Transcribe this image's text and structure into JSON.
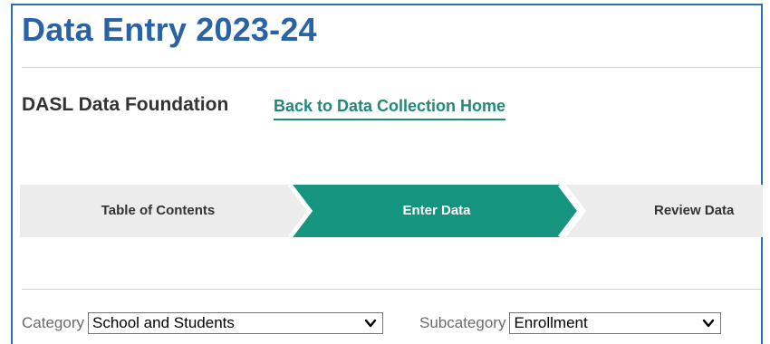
{
  "header": {
    "title": "Data Entry 2023-24"
  },
  "subheader": {
    "org_name": "DASL Data Foundation",
    "back_link": "Back to Data Collection Home"
  },
  "steps": [
    {
      "label": "Table of Contents",
      "state": "inactive"
    },
    {
      "label": "Enter Data",
      "state": "active"
    },
    {
      "label": "Review Data",
      "state": "inactive"
    }
  ],
  "filters": {
    "category": {
      "label": "Category",
      "value": "School and Students"
    },
    "subcategory": {
      "label": "Subcategory",
      "value": "Enrollment"
    }
  },
  "colors": {
    "title": "#2a62a6",
    "frame_border": "#2e6db3",
    "link": "#1f8a78",
    "step_active": "#15957f",
    "step_inactive": "#ececec"
  },
  "icons": {
    "select_chevron": "chevron-down-icon"
  }
}
